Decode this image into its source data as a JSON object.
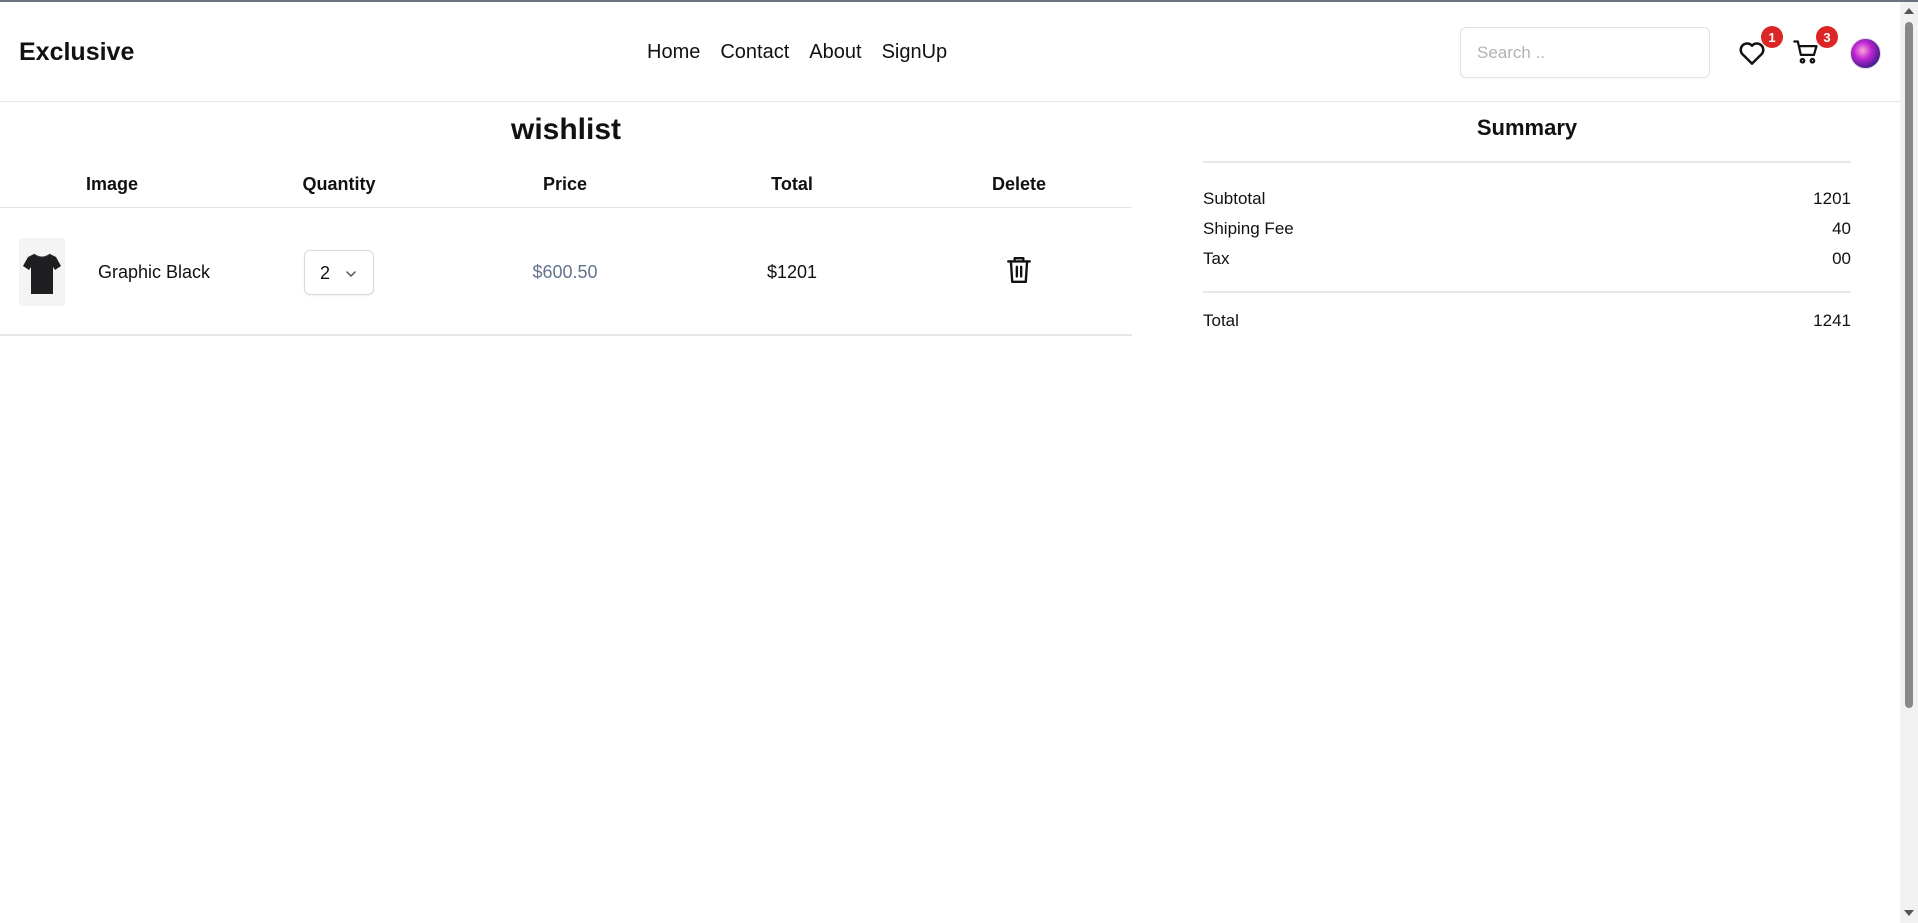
{
  "header": {
    "brand": "Exclusive",
    "nav": [
      "Home",
      "Contact",
      "About",
      "SignUp"
    ],
    "search_placeholder": "Search ..",
    "wishlist_count": "1",
    "cart_count": "3"
  },
  "wishlist": {
    "title": "wishlist",
    "columns": [
      "Image",
      "Quantity",
      "Price",
      "Total",
      "Delete"
    ],
    "items": [
      {
        "name": "Graphic Black",
        "quantity": "2",
        "price": "$600.50",
        "total": "$1201"
      }
    ]
  },
  "summary": {
    "title": "Summary",
    "rows": [
      {
        "label": "Subtotal",
        "value": "1201"
      },
      {
        "label": "Shiping Fee",
        "value": "40"
      },
      {
        "label": "Tax",
        "value": "00"
      }
    ],
    "total_label": "Total",
    "total_value": "1241"
  },
  "colors": {
    "badge": "#dc2626",
    "price_text": "#64748b",
    "divider": "#e5e7eb"
  },
  "icons": [
    "heart-icon",
    "cart-icon",
    "avatar",
    "chevron-down-icon",
    "trash-icon",
    "tshirt-thumbnail"
  ]
}
